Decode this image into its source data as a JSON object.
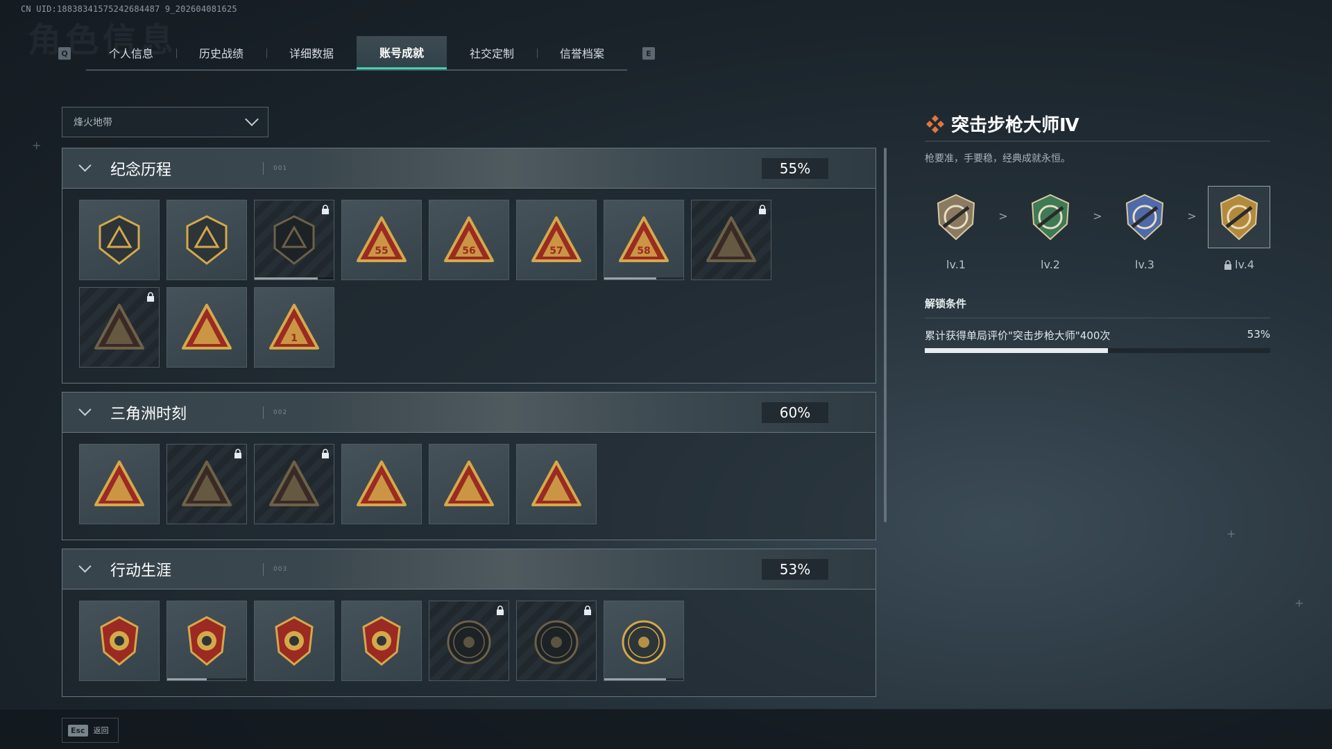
{
  "uid": "CN UID:18838341575242684487 9_202604081625",
  "watermark": "角色信息",
  "tabs": {
    "prev_key": "Q",
    "next_key": "E",
    "items": [
      {
        "label": "个人信息"
      },
      {
        "label": "历史战绩"
      },
      {
        "label": "详细数据"
      },
      {
        "label": "账号成就",
        "active": true
      },
      {
        "label": "社交定制"
      },
      {
        "label": "信誉档案"
      }
    ]
  },
  "mode_select": {
    "value": "烽火地带"
  },
  "categories": [
    {
      "title": "纪念历程",
      "code": "001",
      "percent": "55%",
      "medals": [
        {
          "icon": "triangle-emblem-icon",
          "locked": false
        },
        {
          "icon": "helicopter-shield-icon",
          "locked": false
        },
        {
          "icon": "dark-shield-icon",
          "locked": true,
          "progress": 0.8
        },
        {
          "icon": "season-55-medal-icon",
          "locked": false,
          "number": "55"
        },
        {
          "icon": "season-56-medal-icon",
          "locked": false,
          "number": "56"
        },
        {
          "icon": "season-57-medal-icon",
          "locked": false,
          "number": "57"
        },
        {
          "icon": "season-58-medal-icon",
          "locked": false,
          "number": "58",
          "progress": 0.66
        },
        {
          "icon": "hooded-figure-medal-icon",
          "locked": true
        },
        {
          "icon": "skull-swords-medal-icon",
          "locked": true
        },
        {
          "icon": "golden-bird-medal-icon",
          "locked": false
        },
        {
          "icon": "number-one-medal-icon",
          "locked": false,
          "number": "1"
        }
      ]
    },
    {
      "title": "三角洲时刻",
      "code": "002",
      "percent": "60%",
      "medals": [
        {
          "icon": "supply-box-medal-icon",
          "locked": false
        },
        {
          "icon": "masked-operator-medal-icon",
          "locked": true
        },
        {
          "icon": "crouching-soldier-medal-icon",
          "locked": true
        },
        {
          "icon": "hex-crest-medal-icon",
          "locked": false
        },
        {
          "icon": "squad-medal-icon",
          "locked": false
        },
        {
          "icon": "rocket-medal-icon",
          "locked": false
        }
      ]
    },
    {
      "title": "行动生涯",
      "code": "003",
      "percent": "53%",
      "medals": [
        {
          "icon": "star-skull-badge-icon",
          "locked": false
        },
        {
          "icon": "green-shield-badge-icon",
          "locked": false,
          "progress": 0.5
        },
        {
          "icon": "gold-crest-badge-icon",
          "locked": false
        },
        {
          "icon": "gold-gem-badge-icon",
          "locked": false
        },
        {
          "icon": "coin-emblem-icon",
          "locked": true
        },
        {
          "icon": "crosshair-skull-coin-icon",
          "locked": true
        },
        {
          "icon": "eye-coin-icon",
          "locked": false,
          "progress": 0.78
        }
      ]
    }
  ],
  "detail": {
    "title": "突击步枪大师Ⅳ",
    "description": "枪要准，手要稳，经典成就永恒。",
    "levels": [
      {
        "label": "lv.1",
        "color": "#8a7a62",
        "locked": false
      },
      {
        "label": "lv.2",
        "color": "#3d7a55",
        "locked": false
      },
      {
        "label": "lv.3",
        "color": "#4e6aa8",
        "locked": false
      },
      {
        "label": "lv.4",
        "color": "#b38a3c",
        "locked": true,
        "selected": true
      }
    ],
    "separator": ">",
    "unlock_heading": "解锁条件",
    "condition_text": "累计获得单局评价\"突击步枪大师\"400次",
    "condition_percent": "53%",
    "condition_progress": 0.53
  },
  "footer": {
    "key": "Esc",
    "label": "返回"
  },
  "colors": {
    "accent": "#3fd3b3",
    "medal_gold": "#d4a94a",
    "medal_red": "#9b2a22"
  }
}
